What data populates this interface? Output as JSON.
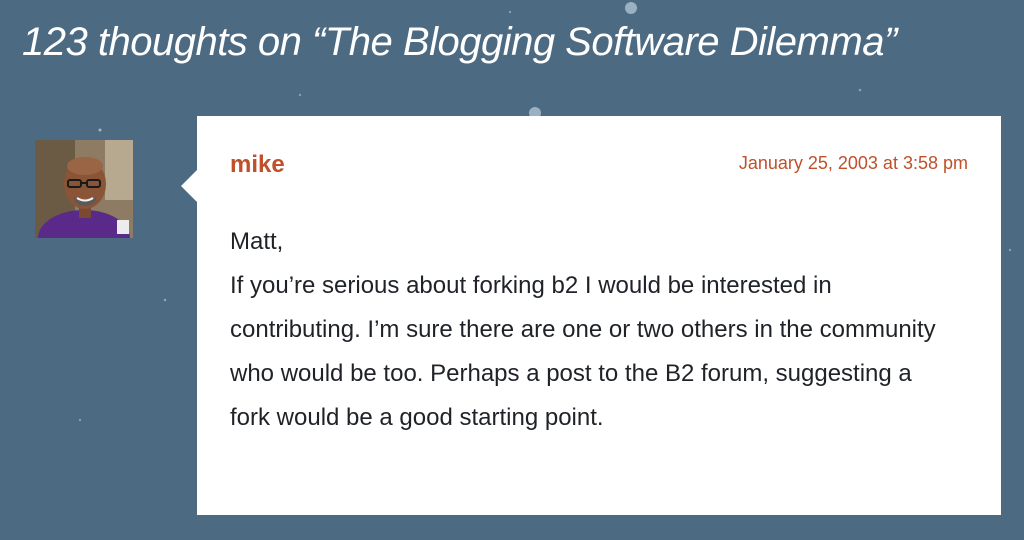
{
  "comments_header": {
    "title": "123 thoughts on “The Blogging Software Dilemma”"
  },
  "comment": {
    "author": "mike",
    "date": "January 25, 2003 at 3:58 pm",
    "greeting": "Matt,",
    "body": "If you’re serious about forking b2 I would be interested in contributing. I’m sure there are one or two others in the community who would be too. Perhaps a post to the B2 forum, suggesting a fork would be a good starting point."
  },
  "colors": {
    "background": "#4d6a83",
    "accent": "#c0502a",
    "card": "#ffffff",
    "text": "#1f2328"
  }
}
